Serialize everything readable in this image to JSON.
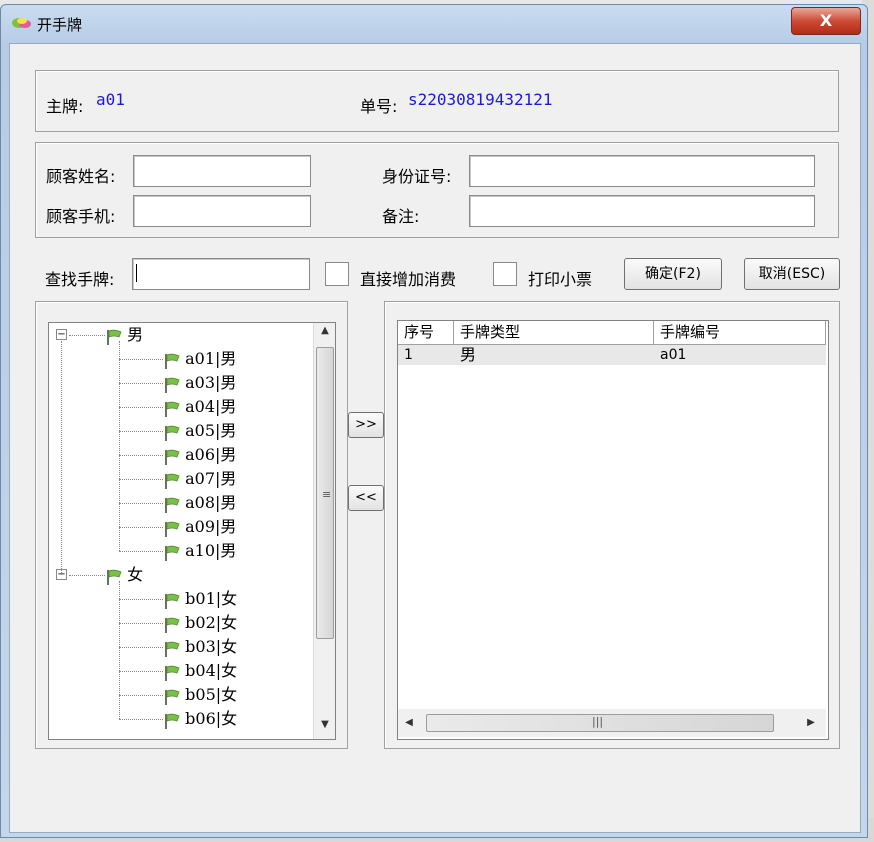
{
  "window": {
    "title": "开手牌",
    "close_label": "X"
  },
  "info": {
    "main_card_label": "主牌:",
    "main_card_value": "a01",
    "order_label": "单号:",
    "order_value": "s22030819432121"
  },
  "customer": {
    "name_label": "顾客姓名:",
    "name_value": "",
    "id_label": "身份证号:",
    "id_value": "",
    "phone_label": "顾客手机:",
    "phone_value": "",
    "remark_label": "备注:",
    "remark_value": ""
  },
  "search": {
    "label": "查找手牌:",
    "value": "",
    "add_consume_label": "直接增加消费",
    "print_label": "打印小票",
    "ok_label": "确定(F2)",
    "cancel_label": "取消(ESC)"
  },
  "move": {
    "right_label": ">>",
    "left_label": "<<"
  },
  "tree": {
    "groups": [
      {
        "label": "男",
        "expander": "−",
        "items": [
          "a01|男",
          "a03|男",
          "a04|男",
          "a05|男",
          "a06|男",
          "a07|男",
          "a08|男",
          "a09|男",
          "a10|男"
        ]
      },
      {
        "label": "女",
        "expander": "−",
        "items": [
          "b01|女",
          "b02|女",
          "b03|女",
          "b04|女",
          "b05|女",
          "b06|女"
        ]
      }
    ]
  },
  "selected_list": {
    "columns": [
      "序号",
      "手牌类型",
      "手牌编号"
    ],
    "rows": [
      [
        "1",
        "男",
        "a01"
      ]
    ]
  },
  "icons": {
    "title": "app-logo-icon",
    "node": "flag-icon"
  }
}
